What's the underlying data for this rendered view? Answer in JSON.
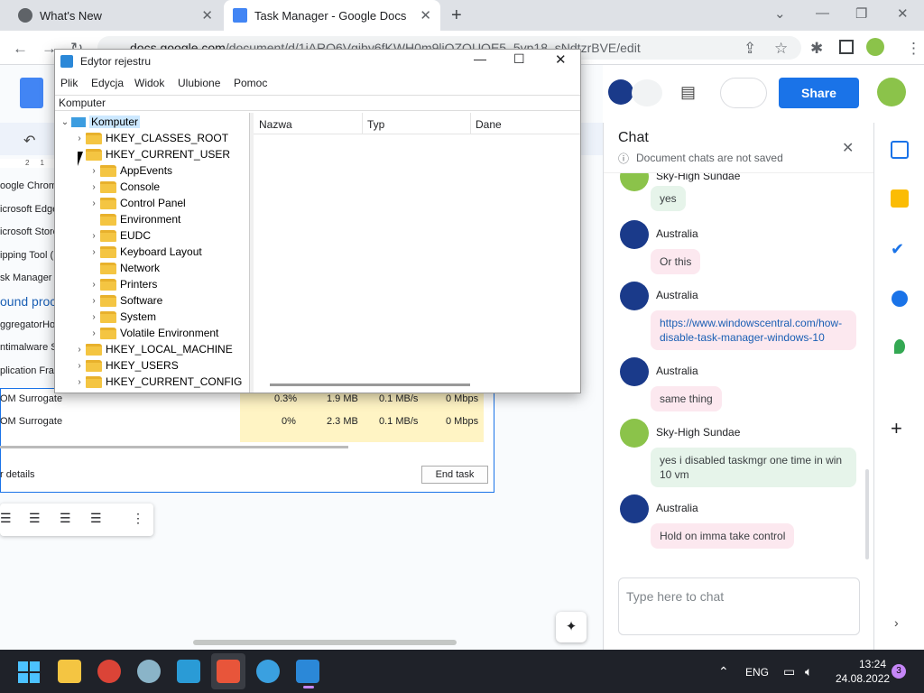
{
  "browser": {
    "tabs": [
      {
        "title": "What's New"
      },
      {
        "title": "Task Manager - Google Docs"
      }
    ],
    "url_domain": "docs.google.com",
    "url_path": "/document/d/1jARQ6Vgjby6fKWH0m9liQZQUQE5_5vp18_sNdtzrBVE/edit"
  },
  "docs": {
    "share_label": "Share",
    "left_fragments": [
      "oogle Chrom",
      "icrosoft Edge",
      "icrosoft Store",
      "ipping Tool (",
      "sk Manager",
      "ound proc",
      "ggregatorHos",
      "ntimalware Se",
      "plication Fra",
      "OM Surrogate",
      "OM Surrogate"
    ],
    "ruler_marks": [
      "2",
      "1"
    ],
    "rows": [
      {
        "name": "OM Surrogate",
        "cpu": "0.3%",
        "mem": "1.9 MB",
        "disk": "0.1 MB/s",
        "net": "0 Mbps"
      },
      {
        "name": "OM Surrogate",
        "cpu": "0%",
        "mem": "2.3 MB",
        "disk": "0.1 MB/s",
        "net": "0 Mbps"
      }
    ],
    "details_label": "r details",
    "end_task_label": "End task"
  },
  "regedit": {
    "title": "Edytor rejestru",
    "menu": [
      "Plik",
      "Edycja",
      "Widok",
      "Ulubione",
      "Pomoc"
    ],
    "address": "Komputer",
    "root": "Komputer",
    "hives_top": [
      "HKEY_CLASSES_ROOT",
      "HKEY_CURRENT_USER"
    ],
    "hkcu_children": [
      "AppEvents",
      "Console",
      "Control Panel",
      "Environment",
      "EUDC",
      "Keyboard Layout",
      "Network",
      "Printers",
      "Software",
      "System",
      "Volatile Environment"
    ],
    "hives_bottom": [
      "HKEY_LOCAL_MACHINE",
      "HKEY_USERS",
      "HKEY_CURRENT_CONFIG"
    ],
    "columns": [
      "Nazwa",
      "Typ",
      "Dane"
    ]
  },
  "chat": {
    "title": "Chat",
    "subtitle": "Document chats are not saved",
    "top_partial_name": "Sky-High Sundae",
    "messages": [
      {
        "author": "",
        "text": "yes",
        "style": "g"
      },
      {
        "author": "Australia",
        "text": "Or this",
        "style": "p"
      },
      {
        "author": "Australia",
        "text": "https://www.windowscentral.com/how-disable-task-manager-windows-10",
        "style": "p"
      },
      {
        "author": "Australia",
        "text": "same thing",
        "style": "p"
      },
      {
        "author": "Sky-High Sundae",
        "text": "yes i disabled taskmgr one time in win 10 vm",
        "style": "g"
      },
      {
        "author": "Australia",
        "text": "Hold on imma take control",
        "style": "p"
      }
    ],
    "input_placeholder": "Type here to chat"
  },
  "taskbar": {
    "lang": "ENG",
    "time": "13:24",
    "date": "24.08.2022",
    "notification_count": "3"
  },
  "colors": {
    "share_blue": "#1a73e8",
    "chrome_tabbar": "#dee1e6",
    "taskbar": "#1f2229",
    "folder": "#f4c542",
    "highlight": "#cce8ff"
  }
}
